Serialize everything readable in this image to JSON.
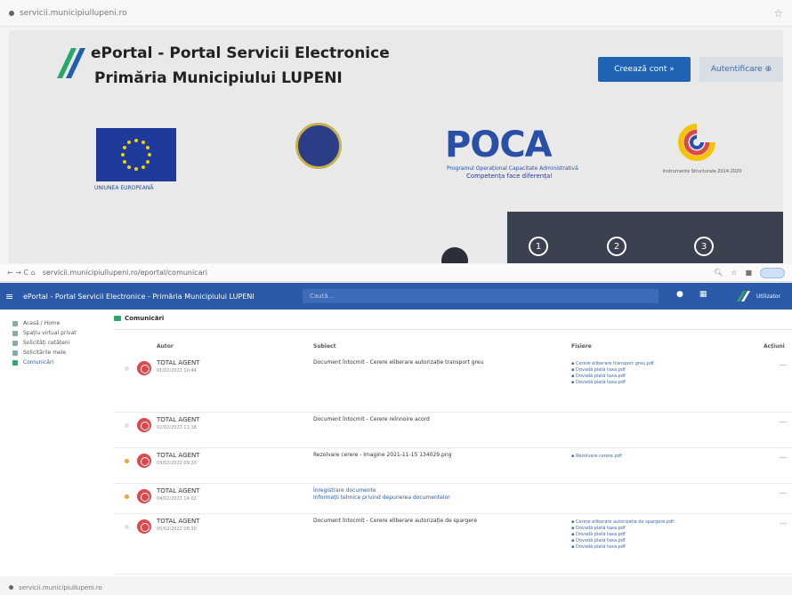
{
  "top_url": "servicii.municipiullupeni.ro",
  "portal": {
    "title": "ePortal - Portal Servicii Electronice",
    "subtitle": "Primăria Municipiului LUPENI",
    "create_button": "Creează cont  »",
    "auth_button": "Autentificare  ⊕",
    "eu_caption": "UNIUNEA EUROPEANĂ",
    "poca_text": "POCA",
    "poca_sub": "Programul Operațional Capacitate Administrativă",
    "poca_sub2": "Competența face diferența!",
    "pop_caption": "Instrumente Structurale 2014-2020",
    "steps": [
      "1",
      "2",
      "3"
    ]
  },
  "browser": {
    "nav": "←  →  C  ⌂",
    "url": "servicii.municipiullupeni.ro/eportal/comunicari"
  },
  "appbar": {
    "title": "ePortal - Portal Servicii Electronice - Primăria Municipiului LUPENI",
    "search_placeholder": "Caută...",
    "user": "Utilizator"
  },
  "sidebar": {
    "items": [
      {
        "label": "Acasă / Home"
      },
      {
        "label": "Spațiu virtual privat"
      },
      {
        "label": "Solicități cetățeni"
      },
      {
        "label": "Solicitările mele"
      },
      {
        "label": "Comunicări"
      }
    ]
  },
  "content": {
    "section_title": "Comunicări",
    "headers": {
      "author": "Autor",
      "subject": "Subiect",
      "attachments": "Fișiere",
      "actions": "Acțiuni"
    },
    "rows": [
      {
        "author": "TOTAL AGENT",
        "date": "01/02/2022 10:44",
        "subject": "Document întocmit - Cerere eliberare autorizație transport greu",
        "attachments": [
          "▪ Cerere eliberare transport greu.pdf",
          "▪ Dovadă plată taxa.pdf",
          "▪ Dovadă plată taxa.pdf",
          "▪ Dovadă plată taxa.pdf"
        ],
        "highlight": false,
        "act": "…"
      },
      {
        "author": "TOTAL AGENT",
        "date": "02/02/2022 11:18",
        "subject": "Document întocmit - Cerere reînnoire acord",
        "attachments": [],
        "highlight": false,
        "act": "…"
      },
      {
        "author": "TOTAL AGENT",
        "date": "03/02/2022 09:20",
        "subject": "Rezolvare cerere - Imagine 2021-11-15 134029.png",
        "attachments": [
          "▪ Rezolvare cerere.pdf"
        ],
        "highlight": true,
        "act": "…"
      },
      {
        "author": "TOTAL AGENT",
        "date": "04/02/2022 14:02",
        "subject": "Înregistrare documente",
        "subject2": "Informații tehnice privind depunerea documentelor",
        "attachments": [],
        "highlight": true,
        "link": true,
        "act": "…"
      },
      {
        "author": "TOTAL AGENT",
        "date": "05/02/2022 08:30",
        "subject": "Document întocmit - Cerere eliberare autorizație de spargere",
        "attachments": [
          "▪ Cerere eliberare autorizație de spargere.pdf",
          "▪ Dovadă plată taxa.pdf",
          "▪ Dovadă plată taxa.pdf",
          "▪ Dovadă plată taxa.pdf",
          "▪ Dovadă plată taxa.pdf"
        ],
        "highlight": false,
        "act": "…"
      }
    ]
  },
  "bottom_url": "servicii.municipiullupeni.ro"
}
